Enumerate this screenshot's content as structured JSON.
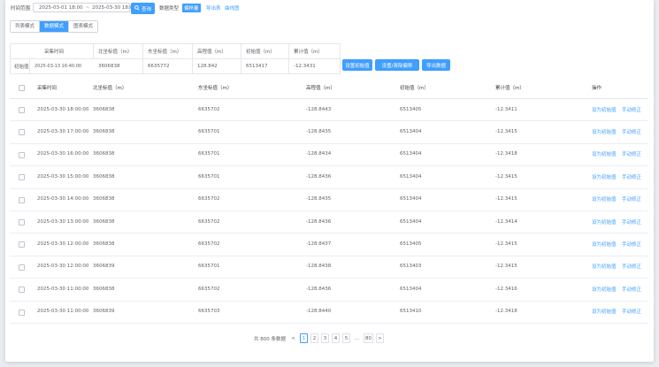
{
  "toolbar": {
    "date_label": "时间范围",
    "date_start": "2025-03-01 18:00",
    "date_sep": "~",
    "date_end": "2025-03-30 18:00",
    "query_label": "查询",
    "query_icon": "search-icon",
    "mode_label": "数据类型",
    "mode_active": "偏移量",
    "link_export": "导出表",
    "link_chart": "曲线图"
  },
  "view_tabs": [
    "列表模式",
    "数据模式",
    "图表模式"
  ],
  "summary": {
    "headers": [
      "采集时间",
      "北坐标值（m）",
      "东坐标值（m）",
      "高程值（m）",
      "初始值（m）",
      "累计值（m）"
    ],
    "row": [
      "初始值",
      "2025-03-13 16:40:00",
      "3606838",
      "6635772",
      "128.842",
      "6513417",
      "-12.3431"
    ],
    "actions": [
      "设置初始值",
      "设置/清除偏移",
      "导出数据"
    ]
  },
  "table": {
    "headers": [
      "采集时间",
      "北坐标值（m）",
      "东坐标值（m）",
      "高程值（m）",
      "初始值（m）",
      "累计值（m）",
      "操作"
    ],
    "rows": [
      [
        "2025-03-30 18:00:00",
        "3606838",
        "6635702",
        "-128.8443",
        "6513405",
        "-12.3411",
        "设为初始值",
        "手动修正"
      ],
      [
        "2025-03-30 17:00:00",
        "3606838",
        "6635701",
        "-128.8435",
        "6513404",
        "-12.3415",
        "设为初始值",
        "手动修正"
      ],
      [
        "2025-03-30 16:00:00",
        "3606838",
        "6635701",
        "-128.8434",
        "6513404",
        "-12.3418",
        "设为初始值",
        "手动修正"
      ],
      [
        "2025-03-30 15:00:00",
        "3606838",
        "6635701",
        "-128.8436",
        "6513404",
        "-12.3415",
        "设为初始值",
        "手动修正"
      ],
      [
        "2025-03-30 14:00:00",
        "3606838",
        "6635702",
        "-128.8435",
        "6513404",
        "-12.3415",
        "设为初始值",
        "手动修正"
      ],
      [
        "2025-03-30 13:00:00",
        "3606838",
        "6635702",
        "-128.8436",
        "6513404",
        "-12.3414",
        "设为初始值",
        "手动修正"
      ],
      [
        "2025-03-30 12:00:00",
        "3606838",
        "6635702",
        "-128.8437",
        "6513405",
        "-12.3415",
        "设为初始值",
        "手动修正"
      ],
      [
        "2025-03-30 12:00:00",
        "3606839",
        "6635701",
        "-128.8438",
        "6513403",
        "-12.3415",
        "设为初始值",
        "手动修正"
      ],
      [
        "2025-03-30 11:00:00",
        "3606838",
        "6635702",
        "-128.8436",
        "6513404",
        "-12.3416",
        "设为初始值",
        "手动修正"
      ],
      [
        "2025-03-30 11:00:00",
        "3606839",
        "6635703",
        "-128.8440",
        "6513410",
        "-12.3418",
        "设为初始值",
        "手动修正"
      ]
    ]
  },
  "pagination": {
    "total_text": "共 800 条数据",
    "prev": "<",
    "pages": [
      "1",
      "2",
      "3",
      "4",
      "5"
    ],
    "active_page": "1",
    "ellipsis": "…",
    "last": "80",
    "next": ">"
  },
  "colors": {
    "accent": "#409eff",
    "background": "#e9ecf1"
  }
}
